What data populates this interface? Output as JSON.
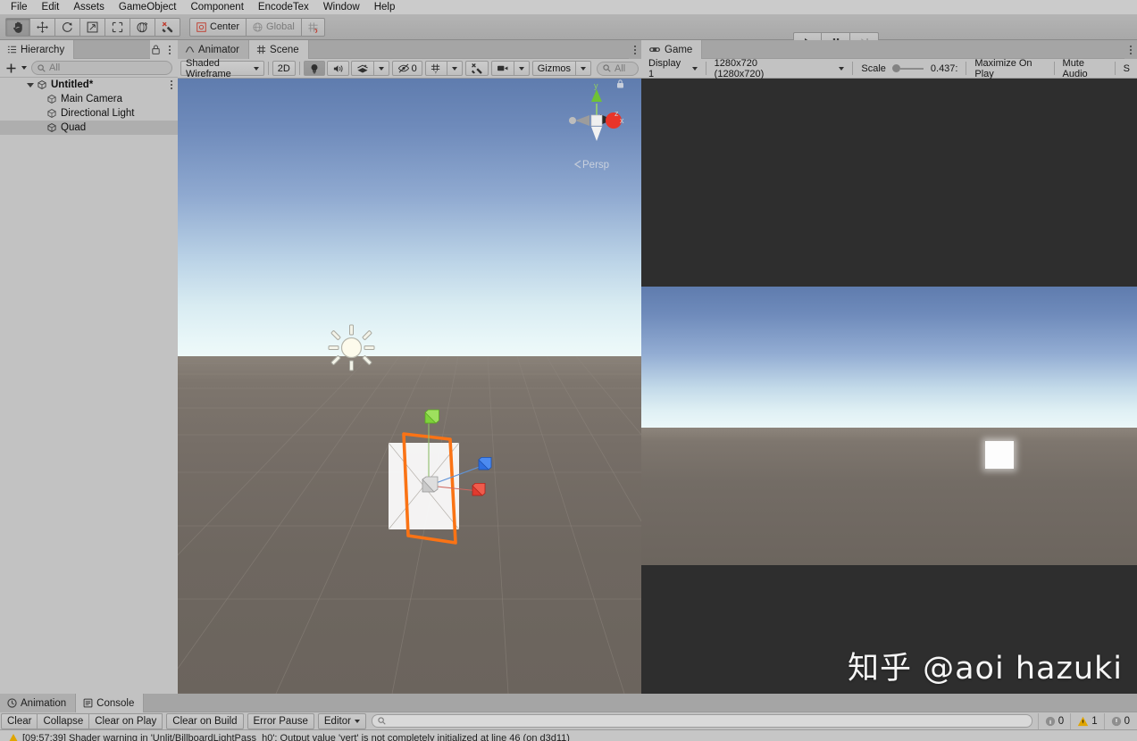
{
  "menubar": {
    "items": [
      {
        "label": "File"
      },
      {
        "label": "Edit"
      },
      {
        "label": "Assets"
      },
      {
        "label": "GameObject"
      },
      {
        "label": "Component"
      },
      {
        "label": "EncodeTex"
      },
      {
        "label": "Window"
      },
      {
        "label": "Help"
      }
    ]
  },
  "toolbar": {
    "tools": [
      {
        "name": "hand-tool",
        "icon": "hand-icon",
        "active": true
      },
      {
        "name": "move-tool",
        "icon": "move-icon",
        "active": false
      },
      {
        "name": "rotate-tool",
        "icon": "rotate-icon",
        "active": false
      },
      {
        "name": "scale-tool",
        "icon": "scale-icon",
        "active": false
      },
      {
        "name": "rect-tool",
        "icon": "rect-icon",
        "active": false
      },
      {
        "name": "transform-tool",
        "icon": "transform-icon",
        "active": false
      },
      {
        "name": "custom-tool",
        "icon": "wrench-icon",
        "active": false
      }
    ],
    "pivot_label": "Center",
    "handle_label": "Global",
    "grid_label": "",
    "play_label": "▶",
    "pause_label": "❙❙",
    "step_label": "▶❘"
  },
  "hierarchy": {
    "tab_label": "Hierarchy",
    "search_placeholder": "All",
    "create_label": "+",
    "items": [
      {
        "label": "Untitled*",
        "depth": 0,
        "expanded": true,
        "selected": false,
        "scene": true
      },
      {
        "label": "Main Camera",
        "depth": 1,
        "expanded": false,
        "selected": false,
        "scene": false
      },
      {
        "label": "Directional Light",
        "depth": 1,
        "expanded": false,
        "selected": false,
        "scene": false
      },
      {
        "label": "Quad",
        "depth": 1,
        "expanded": false,
        "selected": true,
        "scene": false
      }
    ]
  },
  "scene": {
    "tabs": [
      {
        "label": "Animator",
        "icon": "animator-icon",
        "active": false
      },
      {
        "label": "Scene",
        "icon": "scene-icon",
        "active": true
      }
    ],
    "draw_mode": "Shaded Wireframe",
    "two_d_label": "2D",
    "lighting_icon": "lightbulb-icon",
    "audio_icon": "speaker-icon",
    "fx_icon": "effects-icon",
    "hidden_count": "0",
    "hidden_icon": "eye-off-icon",
    "grid_icon": "grid-snap-icon",
    "component_tools_icon": "wrench-icon",
    "camera_icon": "camera-icon",
    "gizmos_label": "Gizmos",
    "search_placeholder": "All",
    "orientation_label": "Persp",
    "axis_x": "x",
    "axis_y": "y",
    "axis_z": "z",
    "lock_icon": "lock-icon"
  },
  "game": {
    "tab_label": "Game",
    "tab_icon": "gamepad-icon",
    "display": "Display 1",
    "resolution": "1280x720 (1280x720)",
    "scale_label": "Scale",
    "scale_value": "0.437:",
    "maximize_label": "Maximize On Play",
    "mute_label": "Mute Audio",
    "stats_label": "S"
  },
  "console": {
    "tabs": [
      {
        "label": "Animation",
        "icon": "animation-icon",
        "active": false
      },
      {
        "label": "Console",
        "icon": "console-icon",
        "active": true
      }
    ],
    "buttons": [
      {
        "label": "Clear"
      },
      {
        "label": "Collapse"
      },
      {
        "label": "Clear on Play"
      },
      {
        "label": "Clear on Build"
      },
      {
        "label": "Error Pause"
      }
    ],
    "editor_label": "Editor",
    "search_placeholder": "",
    "counts": {
      "log": "0",
      "warning": "1",
      "error": "0"
    },
    "messages": [
      {
        "type": "warning",
        "text": "[09:57:39] Shader warning in 'Unlit/BillboardLightPass_h0': Output value 'vert' is not completely initialized at line 46 (on d3d11)"
      }
    ]
  },
  "watermark": {
    "text": "知乎 @aoi hazuki"
  },
  "colors": {
    "chrome": "#c2c2c2",
    "toolbar": "#b4b4b4",
    "selection_orange": "#fa7315",
    "axis_x": "#e03a2f",
    "axis_y": "#5cc21e",
    "axis_z": "#2f6fe0",
    "warning": "#e0a500"
  }
}
